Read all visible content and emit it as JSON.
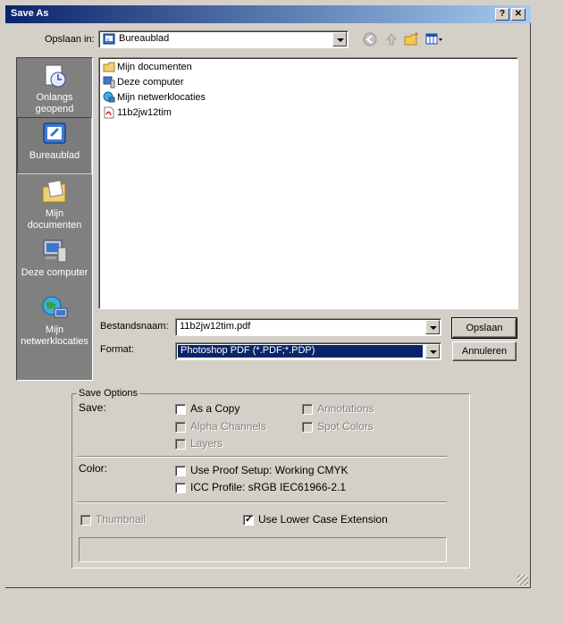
{
  "window": {
    "title": "Save As",
    "help_btn": "?",
    "close_btn": "✕"
  },
  "lookin": {
    "label": "Opslaan in:",
    "value": "Bureaublad"
  },
  "places": [
    {
      "label1": "Onlangs",
      "label2": "geopend"
    },
    {
      "label1": "Bureaublad",
      "label2": ""
    },
    {
      "label1": "Mijn",
      "label2": "documenten"
    },
    {
      "label1": "Deze computer",
      "label2": ""
    },
    {
      "label1": "Mijn",
      "label2": "netwerklocaties"
    }
  ],
  "files": [
    {
      "name": "Mijn documenten",
      "icon": "folder-icon"
    },
    {
      "name": "Deze computer",
      "icon": "computer-icon"
    },
    {
      "name": "Mijn netwerklocaties",
      "icon": "network-icon"
    },
    {
      "name": "11b2jw12tim",
      "icon": "pdf-file-icon"
    }
  ],
  "filename": {
    "label": "Bestandsnaam:",
    "value": "11b2jw12tim.pdf"
  },
  "format": {
    "label": "Format:",
    "value": "Photoshop PDF (*.PDF;*.PDP)"
  },
  "buttons": {
    "save": "Opslaan",
    "cancel": "Annuleren"
  },
  "options": {
    "group_title": "Save Options",
    "save_label": "Save:",
    "as_copy": "As a Copy",
    "annotations": "Annotations",
    "alpha": "Alpha Channels",
    "spot": "Spot Colors",
    "layers": "Layers",
    "color_label": "Color:",
    "proof": "Use Proof Setup:  Working CMYK",
    "icc": "ICC Profile:  sRGB IEC61966-2.1",
    "thumbnail": "Thumbnail",
    "lowercase": "Use Lower Case Extension"
  },
  "colors": {
    "titlebar_start": "#0a246a",
    "titlebar_end": "#a6caf0",
    "selection": "#0a246a"
  }
}
